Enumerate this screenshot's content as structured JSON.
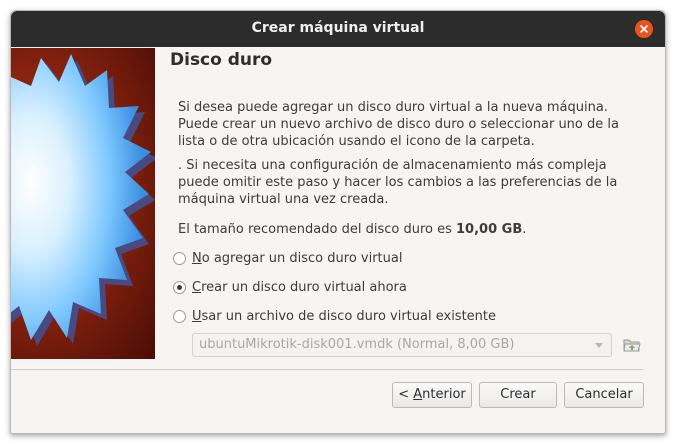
{
  "window": {
    "title": "Crear máquina virtual",
    "close_icon": "close-icon",
    "accent_color": "#e95420"
  },
  "page": {
    "heading": "Disco duro",
    "paragraph1": "Si desea puede agregar un disco duro virtual a la nueva máquina. Puede crear un nuevo archivo de disco duro o seleccionar uno de la lista o de otra ubicación usando el icono de la carpeta.",
    "paragraph2": ". Si necesita una configuración de almacenamiento más compleja puede omitir este paso y hacer los cambios a las preferencias de la máquina virtual una vez creada.",
    "size_prefix": "El tamaño recomendado del disco duro es ",
    "size_value": "10,00 GB",
    "size_suffix": "."
  },
  "options": [
    {
      "mnemonic": "N",
      "rest": "o agregar un disco duro virtual",
      "selected": false
    },
    {
      "mnemonic": "C",
      "rest": "rear un disco duro virtual ahora",
      "selected": true
    },
    {
      "mnemonic": "U",
      "rest": "sar un archivo de disco duro virtual existente",
      "selected": false
    }
  ],
  "disk_select": {
    "value": "ubuntuMikrotik-disk001.vmdk (Normal, 8,00 GB)",
    "enabled": false
  },
  "buttons": {
    "back_prefix": "< ",
    "back_mnemonic": "A",
    "back_rest": "nterior",
    "create": "Crear",
    "cancel": "Cancelar"
  }
}
